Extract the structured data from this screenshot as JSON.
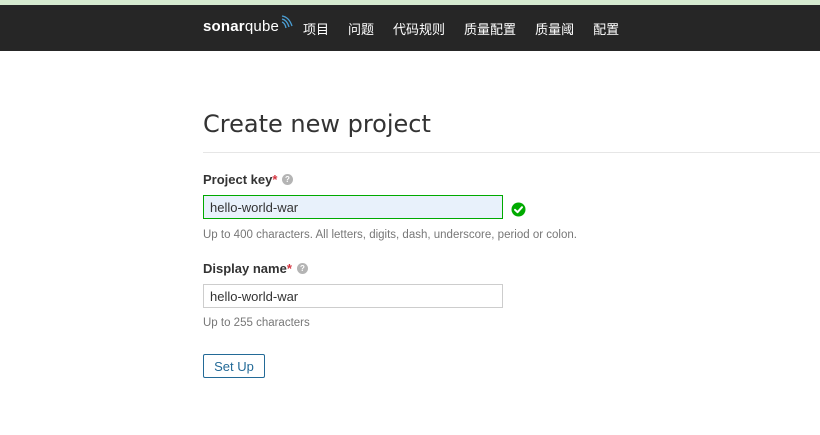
{
  "navbar": {
    "logo_bold": "sonar",
    "logo_light": "qube",
    "items": [
      "项目",
      "问题",
      "代码规则",
      "质量配置",
      "质量阈",
      "配置"
    ]
  },
  "page": {
    "title": "Create new project"
  },
  "form": {
    "project_key": {
      "label": "Project key",
      "required_marker": "*",
      "value": "hello-world-war",
      "hint": "Up to 400 characters. All letters, digits, dash, underscore, period or colon.",
      "status": "valid"
    },
    "display_name": {
      "label": "Display name",
      "required_marker": "*",
      "value": "hello-world-war",
      "hint": "Up to 255 characters"
    },
    "submit_label": "Set Up"
  },
  "colors": {
    "navbar_bg": "#262626",
    "valid_green": "#00aa00",
    "button_blue": "#236a97",
    "required_red": "#d4333f"
  }
}
